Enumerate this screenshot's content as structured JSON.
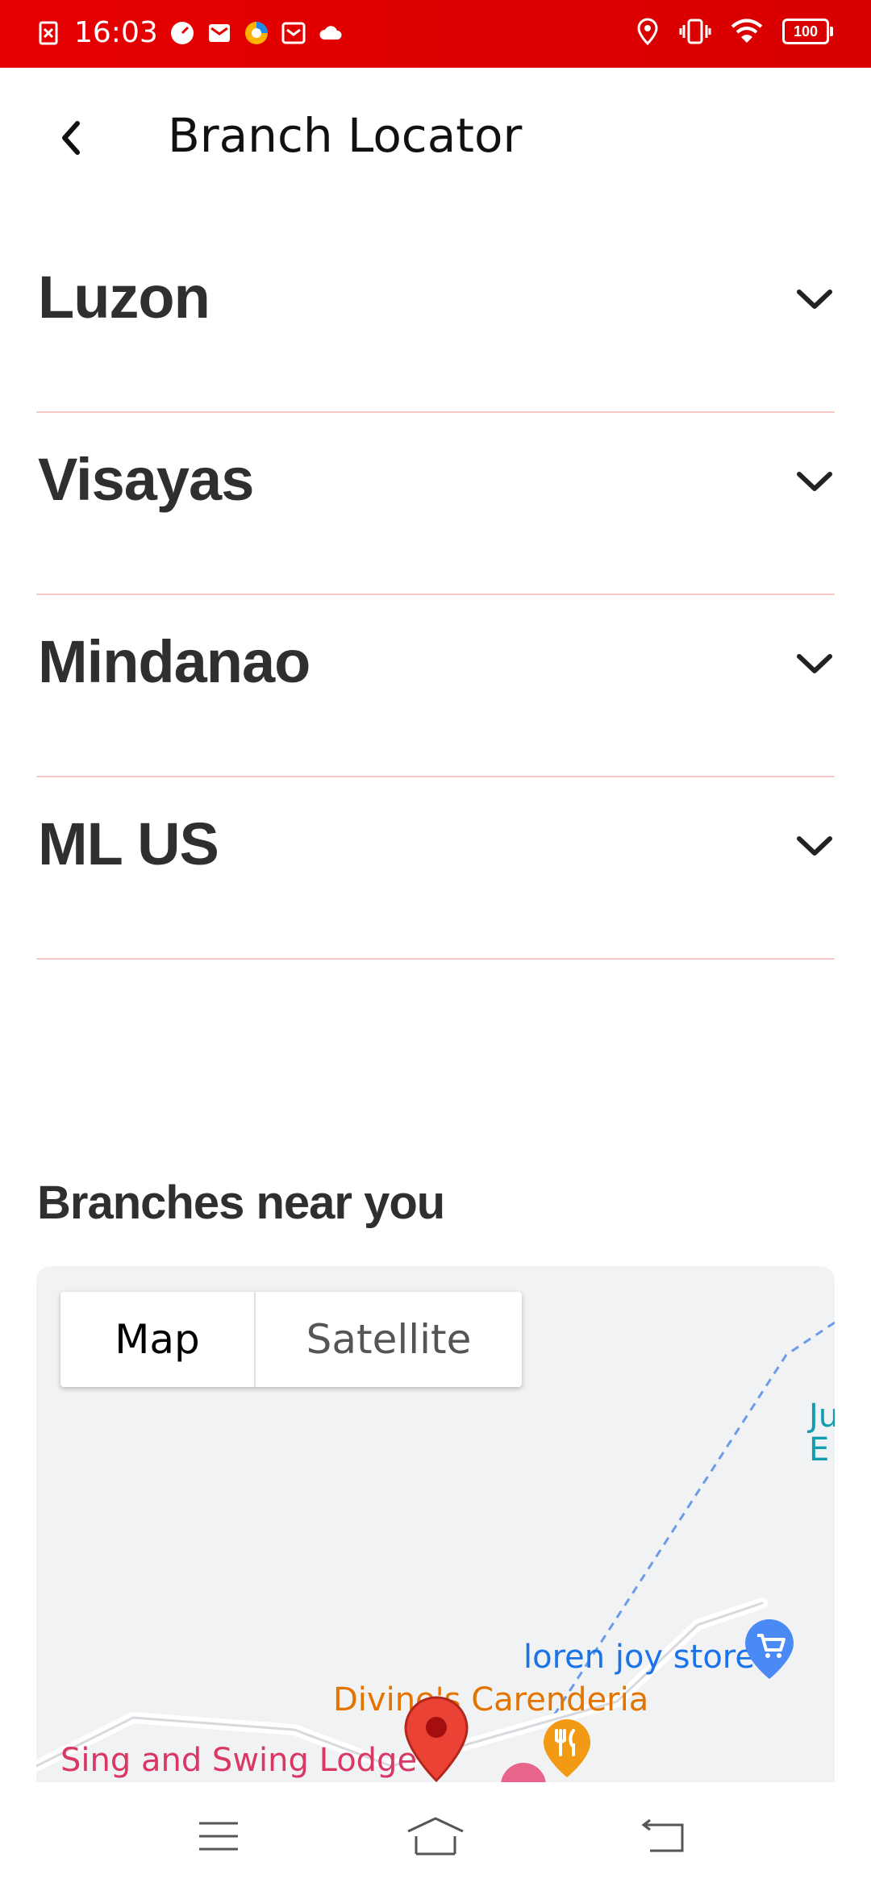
{
  "status": {
    "time": "16:03",
    "battery": "100"
  },
  "header": {
    "title": "Branch Locator"
  },
  "regions": [
    {
      "label": "Luzon"
    },
    {
      "label": "Visayas"
    },
    {
      "label": "Mindanao"
    },
    {
      "label": "ML US"
    }
  ],
  "near": {
    "title": "Branches near you"
  },
  "map": {
    "toggle": {
      "map": "Map",
      "satellite": "Satellite"
    },
    "places": {
      "store": "loren joy store",
      "carenderia": "Divine's Carenderia",
      "lodge": "Sing and Swing Lodge",
      "edge_top": "Ju",
      "edge_bottom": "E"
    }
  },
  "colors": {
    "status_bar": "#e50000",
    "divider": "#f4c6c6"
  }
}
